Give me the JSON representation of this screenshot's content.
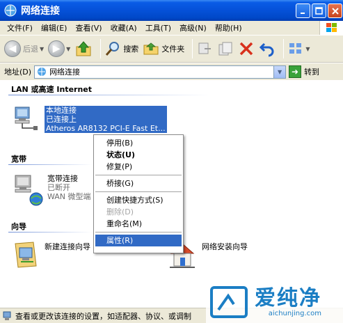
{
  "window": {
    "title": "网络连接"
  },
  "menubar": {
    "items": [
      "文件(F)",
      "编辑(E)",
      "查看(V)",
      "收藏(A)",
      "工具(T)",
      "高级(N)",
      "帮助(H)"
    ]
  },
  "toolbar": {
    "back_label": "后退",
    "search_label": "搜索",
    "folders_label": "文件夹"
  },
  "addressbar": {
    "label": "地址(D)",
    "value": "网络连接",
    "go_label": "转到"
  },
  "groups": {
    "lan_header": "LAN 或高速 Internet",
    "broadband_header": "宽带",
    "wizard_header": "向导"
  },
  "connections": {
    "local": {
      "name": "本地连接",
      "status": "已连接上",
      "device": "Atheros AR8132 PCI-E Fast Et..."
    },
    "broadband": {
      "name": "宽带连接",
      "status": "已断开",
      "device": "WAN 微型端"
    },
    "new_wizard": {
      "name": "新建连接向导"
    },
    "home_wizard": {
      "name": "网络安装向导"
    }
  },
  "context_menu": {
    "items": [
      {
        "label": "停用(B)"
      },
      {
        "label": "状态(U)"
      },
      {
        "label": "修复(P)"
      },
      {
        "label": "桥接(G)"
      },
      {
        "label": "创建快捷方式(S)"
      },
      {
        "label": "删除(D)"
      },
      {
        "label": "重命名(M)"
      },
      {
        "label": "属性(R)"
      }
    ]
  },
  "statusbar": {
    "text": "查看或更改该连接的设置，如适配器、协议、或调制"
  },
  "watermark": {
    "title": "爱纯净",
    "url": "aichunjing.com"
  },
  "colors": {
    "title_bar": "#0551d8",
    "selection": "#316ac5",
    "watermark": "#1b7ec4"
  }
}
